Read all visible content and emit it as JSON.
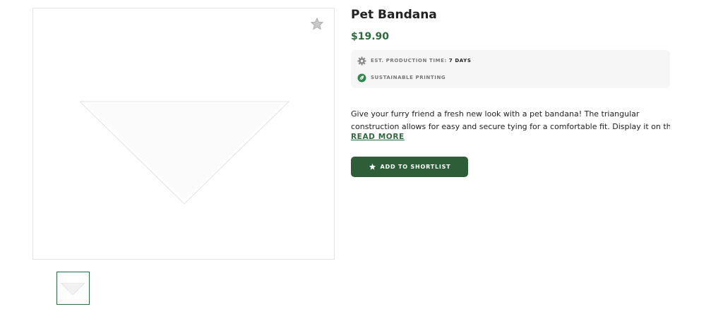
{
  "product": {
    "title": "Pet Bandana",
    "price": "$19.90",
    "meta": {
      "production_label": "EST. PRODUCTION TIME:",
      "production_value": "7 DAYS",
      "sustainable_label": "SUSTAINABLE PRINTING"
    },
    "description_line1": "Give your furry friend a fresh new look with a pet bandana! The triangular",
    "description_line2": "construction allows for easy and secure tying for a comfortable fit. Display it on the...",
    "read_more": "READ MORE",
    "add_button": "ADD TO SHORTLIST"
  },
  "icons": {
    "favorite": "star-icon",
    "production": "gear-icon",
    "sustainable": "leaf-icon",
    "button": "star-icon"
  },
  "colors": {
    "accent": "#2d6a3e",
    "button": "#2d5e38",
    "meta_bg": "#f6f6f6"
  }
}
